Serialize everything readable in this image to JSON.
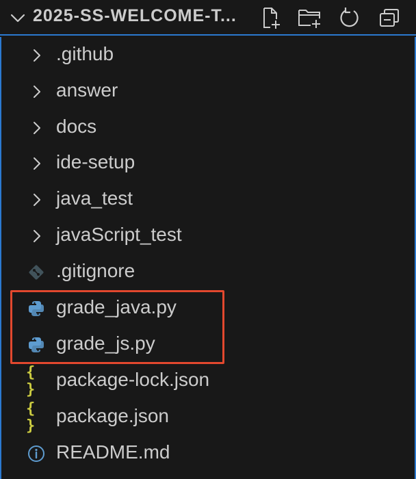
{
  "explorer": {
    "title": "2025-SS-WELCOME-T...",
    "actions": [
      {
        "name": "new-file-icon"
      },
      {
        "name": "new-folder-icon"
      },
      {
        "name": "refresh-icon"
      },
      {
        "name": "collapse-all-icon"
      }
    ]
  },
  "items": [
    {
      "label": ".github",
      "kind": "folder",
      "icon": "chevron-right-icon"
    },
    {
      "label": "answer",
      "kind": "folder",
      "icon": "chevron-right-icon"
    },
    {
      "label": "docs",
      "kind": "folder",
      "icon": "chevron-right-icon"
    },
    {
      "label": "ide-setup",
      "kind": "folder",
      "icon": "chevron-right-icon"
    },
    {
      "label": "java_test",
      "kind": "folder",
      "icon": "chevron-right-icon"
    },
    {
      "label": "javaScript_test",
      "kind": "folder",
      "icon": "chevron-right-icon"
    },
    {
      "label": ".gitignore",
      "kind": "file",
      "icon": "git-icon"
    },
    {
      "label": "grade_java.py",
      "kind": "file",
      "icon": "python-icon"
    },
    {
      "label": "grade_js.py",
      "kind": "file",
      "icon": "python-icon"
    },
    {
      "label": "package-lock.json",
      "kind": "file",
      "icon": "json-icon",
      "glyph": "{ }"
    },
    {
      "label": "package.json",
      "kind": "file",
      "icon": "json-icon",
      "glyph": "{ }"
    },
    {
      "label": "README.md",
      "kind": "file",
      "icon": "info-icon"
    }
  ],
  "colors": {
    "accent_border": "#2b79d0",
    "highlight": "#e2482e",
    "json_icon": "#cbcb41",
    "python_icon": "#5e9cd0",
    "info_icon": "#5e9cd0",
    "text": "#cccccc",
    "background": "#181818"
  }
}
